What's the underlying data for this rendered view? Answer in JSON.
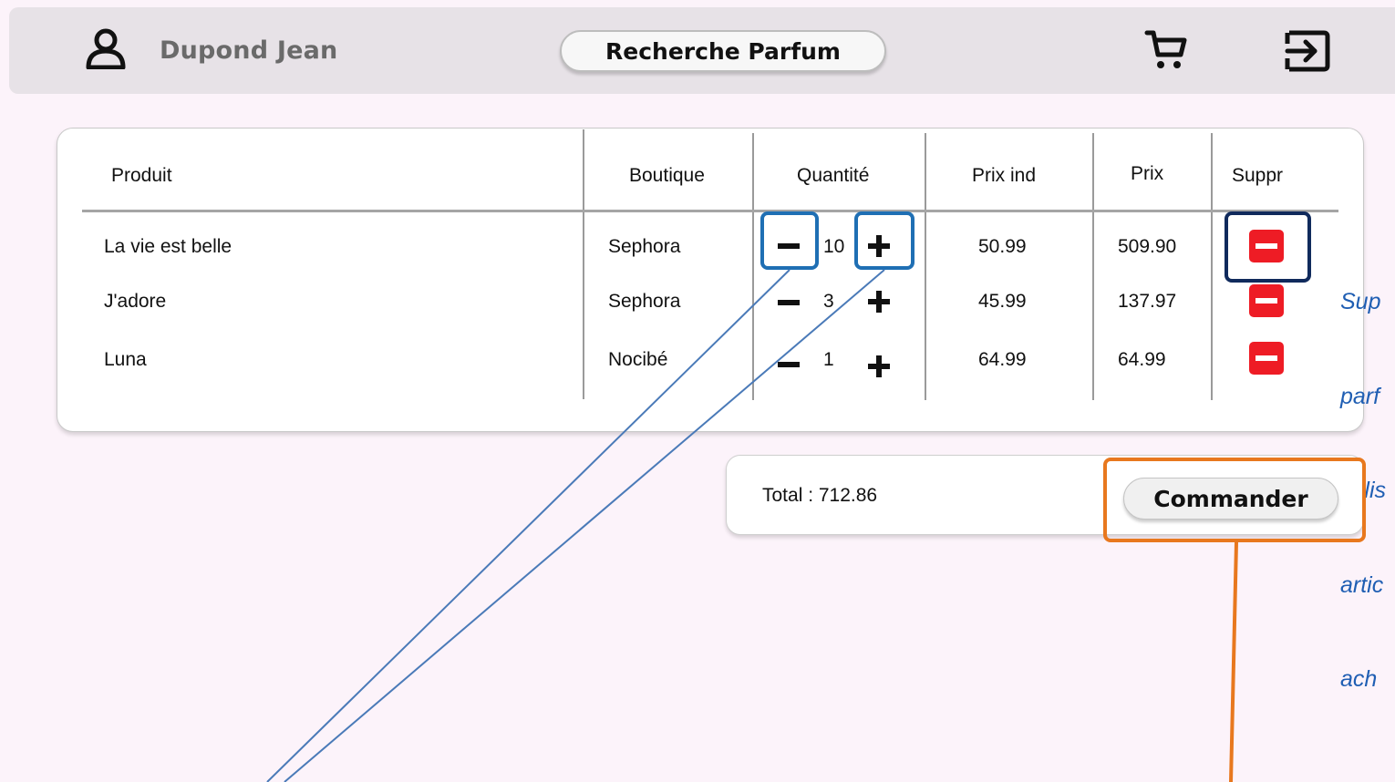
{
  "header": {
    "user_name": "Dupond Jean",
    "search_label": "Recherche Parfum",
    "icons": {
      "user": "user-icon",
      "cart": "cart-icon",
      "logout": "logout-icon"
    }
  },
  "table": {
    "columns": [
      "Produit",
      "Boutique",
      "Quantité",
      "Prix ind",
      "Prix",
      "Suppr"
    ],
    "rows": [
      {
        "product": "La vie est belle",
        "shop": "Sephora",
        "quantity": "10",
        "unit_price": "50.99",
        "price": "509.90"
      },
      {
        "product": "J'adore",
        "shop": "Sephora",
        "quantity": "3",
        "unit_price": "45.99",
        "price": "137.97"
      },
      {
        "product": "Luna",
        "shop": "Nocibé",
        "quantity": "1",
        "unit_price": "64.99",
        "price": "64.99"
      }
    ]
  },
  "annotation": {
    "lines": [
      "Sup",
      "parf",
      "la lis",
      "artic",
      "ach"
    ]
  },
  "summary": {
    "total": "Total : 712.86",
    "order_label": "Commander"
  },
  "colors": {
    "background": "#fcf3fa",
    "header": "#e7e2e7",
    "delete": "#ee1c25",
    "highlight_blue": "#1f6fb4",
    "highlight_navy": "#102a5c",
    "highlight_orange": "#e8781e",
    "annotation_text": "#1f5eb3"
  }
}
